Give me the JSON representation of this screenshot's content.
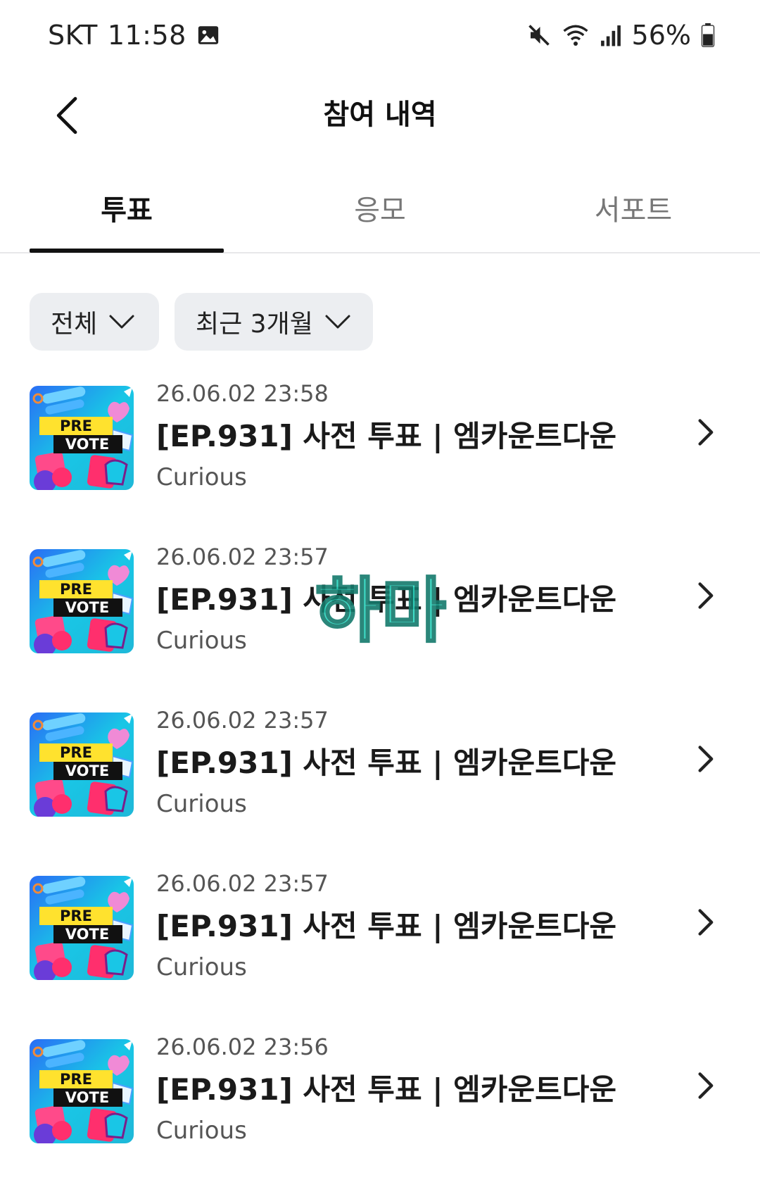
{
  "status": {
    "carrier": "SKT",
    "time": "11:58",
    "battery": "56%"
  },
  "header": {
    "title": "참여 내역"
  },
  "tabs": [
    {
      "label": "투표",
      "active": true
    },
    {
      "label": "응모",
      "active": false
    },
    {
      "label": "서포트",
      "active": false
    }
  ],
  "filters": {
    "category": "전체",
    "period": "최근 3개월"
  },
  "items": [
    {
      "date": "26.06.02 23:58",
      "title": "[EP.931] 사전 투표 | 엠카운트다운",
      "subtitle": "Curious",
      "thumb_top": "PRE",
      "thumb_bottom": "VOTE"
    },
    {
      "date": "26.06.02 23:57",
      "title": "[EP.931] 사전 투표 | 엠카운트다운",
      "subtitle": "Curious",
      "thumb_top": "PRE",
      "thumb_bottom": "VOTE"
    },
    {
      "date": "26.06.02 23:57",
      "title": "[EP.931] 사전 투표 | 엠카운트다운",
      "subtitle": "Curious",
      "thumb_top": "PRE",
      "thumb_bottom": "VOTE"
    },
    {
      "date": "26.06.02 23:57",
      "title": "[EP.931] 사전 투표 | 엠카운트다운",
      "subtitle": "Curious",
      "thumb_top": "PRE",
      "thumb_bottom": "VOTE"
    },
    {
      "date": "26.06.02 23:56",
      "title": "[EP.931] 사전 투표 | 엠카운트다운",
      "subtitle": "Curious",
      "thumb_top": "PRE",
      "thumb_bottom": "VOTE"
    }
  ],
  "watermark": "하마",
  "colors": {
    "active_tab": "#111111",
    "chip_bg": "#eceef1",
    "watermark": "#2bd9c2"
  }
}
